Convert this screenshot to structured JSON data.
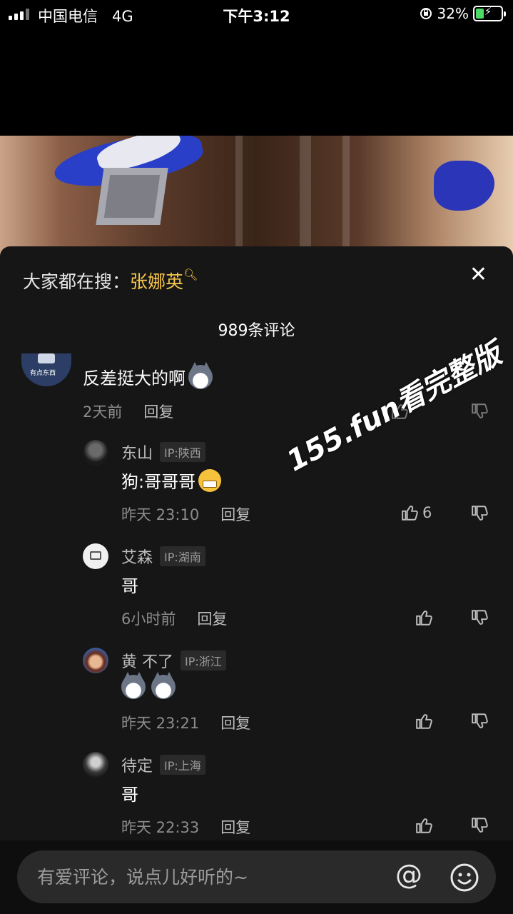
{
  "status_bar": {
    "carrier": "中国电信",
    "network": "4G",
    "time": "下午3:12",
    "battery": "32%",
    "battery_level": 0.32
  },
  "sheet": {
    "search_prefix": "大家都在搜：",
    "search_keyword": "张娜英",
    "comment_count": "989条评论"
  },
  "comments": [
    {
      "text": "反差挺大的啊",
      "time": "2天前",
      "reply": "回复",
      "emoji": "cat-emoji"
    },
    {
      "name": "东山",
      "ip": "IP:陕西",
      "text": "狗:哥哥哥",
      "time": "昨天 23:10",
      "reply": "回复",
      "likes": "6",
      "emoji": "grin-sweat-emoji"
    },
    {
      "name": "艾森",
      "ip": "IP:湖南",
      "text": "哥",
      "time": "6小时前",
      "reply": "回复"
    },
    {
      "name": "黄  不了",
      "ip": "IP:浙江",
      "time": "昨天 23:21",
      "reply": "回复",
      "emoji": "cat-emoji"
    },
    {
      "name": "待定",
      "ip": "IP:上海",
      "text": "哥",
      "time": "昨天 22:33",
      "reply": "回复"
    }
  ],
  "watermark": "155.fun看完整版",
  "input": {
    "placeholder": "有爱评论，说点儿好听的~"
  },
  "colors": {
    "accent": "#f7c64b",
    "sheet_bg": "#161616",
    "battery_green": "#4cd964"
  }
}
